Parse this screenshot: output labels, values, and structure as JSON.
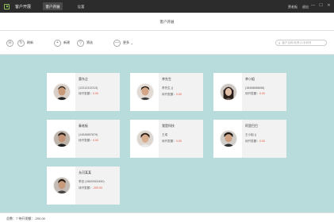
{
  "app": {
    "title": "客户开展",
    "user": "贾老板",
    "logout": "退出"
  },
  "nav": {
    "tabs": [
      {
        "label": "客户开展"
      },
      {
        "label": "设置"
      }
    ]
  },
  "window": {
    "minimize": "—",
    "maximize": "☐",
    "close": "✕"
  },
  "page": {
    "title": "客户开展"
  },
  "toolbar": {
    "refresh_label": "刷新",
    "new_label": "新建",
    "filter_label": "筛选",
    "more_label": "更多",
    "search_placeholder": "客户名称/负责人/手机号"
  },
  "cards": [
    {
      "name": "惠东企",
      "contact": "(12312312313)",
      "amount_label": "待开发额：",
      "amount": "0.00"
    },
    {
      "name": "李先生",
      "contact": "李先生 ()",
      "amount_label": "待开发额：",
      "amount": "0.00"
    },
    {
      "name": "李小姐",
      "contact": "(18458658658)",
      "amount_label": "待开发额：",
      "amount": "0.00"
    },
    {
      "name": "秦老板",
      "contact": "(14545657879)",
      "amount_label": "待开发额：",
      "amount": "0.00"
    },
    {
      "name": "我是科技",
      "contact": "王成",
      "amount_label": "待开发额：",
      "amount": "0.00"
    },
    {
      "name": "阿里巴巴",
      "contact": "王小姐 ()",
      "amount_label": "待开发额：",
      "amount": "0.00"
    },
    {
      "name": "允河某某",
      "contact": "李总 (18629302450)",
      "amount_label": "待开发额：",
      "amount": "-200.00"
    }
  ],
  "footer": {
    "text": "总数：7    待开发额：-200.00"
  },
  "colors": {
    "topbar": "#2c2c2c",
    "background": "#b7dcdb",
    "amount": "#e0523a",
    "logo": "#8fbf5a"
  }
}
